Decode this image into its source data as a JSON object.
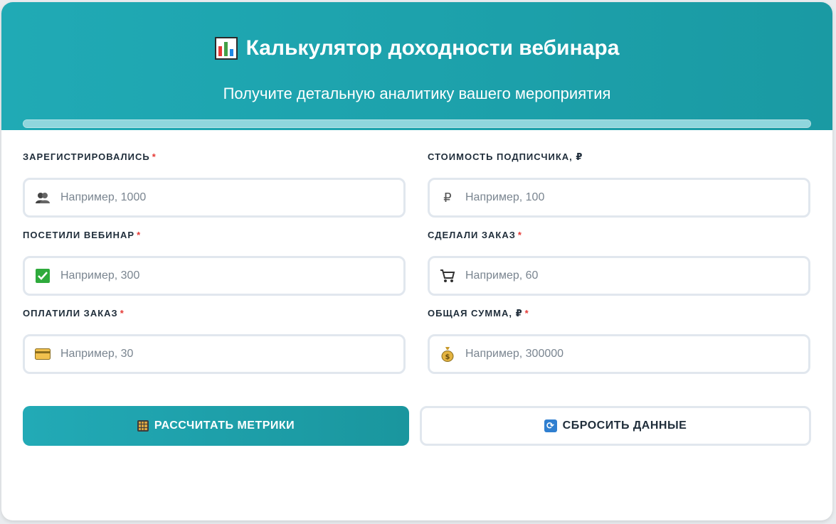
{
  "header": {
    "title": "Калькулятор доходности вебинара",
    "title_icon": "bar-chart-icon",
    "subtitle": "Получите детальную аналитику вашего мероприятия",
    "progress": 1.0
  },
  "fields": [
    {
      "label": "ЗАРЕГИСТРИРОВАЛИСЬ",
      "required": "*",
      "placeholder": "Например, 1000",
      "value": "",
      "icon": "people-icon"
    },
    {
      "label": "СТОИМОСТЬ ПОДПИСЧИКА, ₽",
      "required": "",
      "placeholder": "Например, 100",
      "value": "",
      "icon": "ruble-icon",
      "icon_glyph": "₽"
    },
    {
      "label": "ПОСЕТИЛИ ВЕБИНАР",
      "required": "*",
      "placeholder": "Например, 300",
      "value": "",
      "icon": "checkmark-icon"
    },
    {
      "label": "СДЕЛАЛИ ЗАКАЗ",
      "required": "*",
      "placeholder": "Например, 60",
      "value": "",
      "icon": "shopping-cart-icon"
    },
    {
      "label": "ОПЛАТИЛИ ЗАКАЗ",
      "required": "*",
      "placeholder": "Например, 30",
      "value": "",
      "icon": "credit-card-icon"
    },
    {
      "label": "ОБЩАЯ СУММА, ₽",
      "required": "*",
      "placeholder": "Например, 300000",
      "value": "",
      "icon": "money-bag-icon"
    }
  ],
  "buttons": {
    "calculate_label": "РАССЧИТАТЬ МЕТРИКИ",
    "calculate_icon": "abacus-icon",
    "reset_label": "СБРОСИТЬ ДАННЫЕ",
    "reset_icon": "refresh-icon",
    "refresh_glyph": "⟳"
  },
  "colors": {
    "accent": "#1fa5af",
    "required": "#e53935"
  }
}
